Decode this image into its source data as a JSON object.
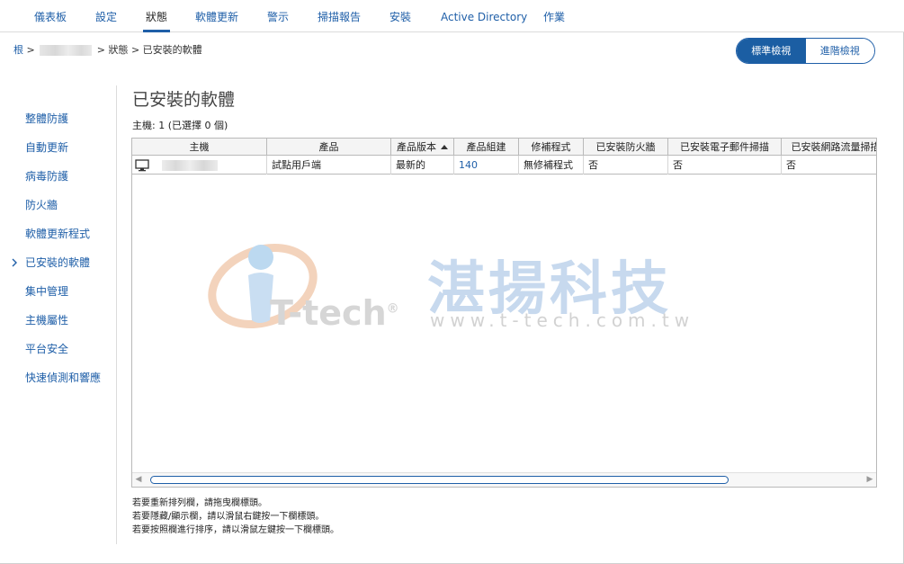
{
  "topnav": {
    "tabs": [
      {
        "label": "儀表板"
      },
      {
        "label": "設定"
      },
      {
        "label": "狀態"
      },
      {
        "label": "軟體更新"
      },
      {
        "label": "警示"
      },
      {
        "label": "掃描報告"
      },
      {
        "label": "安裝"
      },
      {
        "label": "Active Directory"
      },
      {
        "label": "作業"
      }
    ],
    "active_tab": "狀態"
  },
  "breadcrumb": {
    "root": "根",
    "sep": ">",
    "status": "狀態",
    "current": "已安裝的軟體"
  },
  "view_toggle": {
    "standard": "標準檢視",
    "advanced": "進階檢視",
    "selected": "標準檢視"
  },
  "sidebar": {
    "items": [
      {
        "label": "整體防護"
      },
      {
        "label": "自動更新"
      },
      {
        "label": "病毒防護"
      },
      {
        "label": "防火牆"
      },
      {
        "label": "軟體更新程式"
      },
      {
        "label": "已安裝的軟體"
      },
      {
        "label": "集中管理"
      },
      {
        "label": "主機屬性"
      },
      {
        "label": "平台安全"
      },
      {
        "label": "快速偵測和響應"
      }
    ],
    "current": "已安裝的軟體"
  },
  "main": {
    "title": "已安裝的軟體",
    "host_count": "主機: 1 (已選擇 0 個)"
  },
  "table": {
    "columns": [
      "主機",
      "產品",
      "產品版本",
      "產品組建",
      "修補程式",
      "已安裝防火牆",
      "已安裝電子郵件掃描",
      "已安裝網路流量掃描"
    ],
    "sorted_column": "產品版本",
    "sort_direction": "ascending",
    "rows": [
      {
        "product": "試點用戶端",
        "version": "最新的",
        "build": "140",
        "patch": "無修補程式",
        "firewall": "否",
        "email_scan": "否",
        "traffic_scan": "否"
      }
    ]
  },
  "watermark": {
    "brand": "湛揚科技",
    "logo_text": "T-tech",
    "registered": "®",
    "url": "www.t-tech.com.tw"
  },
  "hints": [
    "若要重新排列欄，請拖曳欄標頭。",
    "若要隱藏/顯示欄，請以滑鼠右鍵按一下欄標頭。",
    "若要按照欄進行排序，請以滑鼠左鍵按一下欄標頭。"
  ],
  "colors": {
    "accent": "#1f5fa8",
    "accent_dark": "#1b5ea3",
    "border": "#b9b9b9"
  },
  "icons": {
    "host": "computer-monitor-icon",
    "sidebar_current": "chevron-right-icon",
    "sort": "sort-ascending-icon"
  }
}
